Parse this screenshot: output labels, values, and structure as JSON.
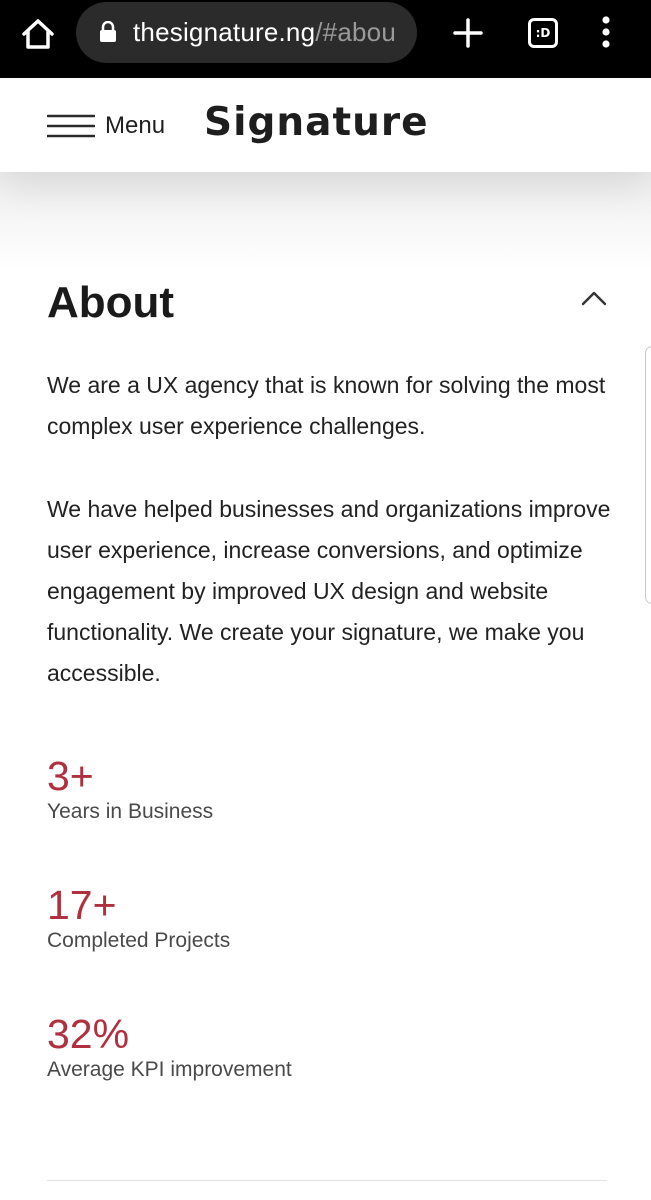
{
  "browser": {
    "url_host": "thesignature.ng",
    "url_path": "/#abou",
    "tabs_label": ":D",
    "icons": [
      "home-icon",
      "lock-icon",
      "plus-icon",
      "tabs-icon",
      "more-vert-icon"
    ]
  },
  "header": {
    "menu_label": "Menu",
    "logo_text": "Signature"
  },
  "about": {
    "title": "About",
    "paragraphs": [
      "We are a UX agency that is known for solving the most complex user experience challenges.",
      "We have helped businesses and organizations improve user experience, increase conversions, and optimize engagement by improved UX design and website functionality. We create your signature, we make you accessible."
    ],
    "stats": [
      {
        "value": "3+",
        "label": "Years in Business"
      },
      {
        "value": "17+",
        "label": "Completed Projects"
      },
      {
        "value": "32%",
        "label": "Average KPI improvement"
      }
    ]
  },
  "colors": {
    "accent": "#b0303f",
    "browser_bar": "#000000",
    "text": "#222222"
  }
}
